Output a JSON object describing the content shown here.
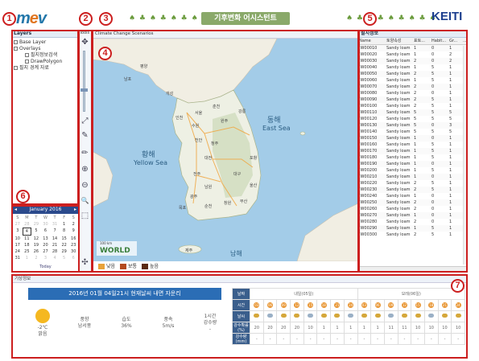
{
  "header": {
    "logo_prefix": "m",
    "logo_o": "e",
    "logo_suffix": "v",
    "title": "기후변화 어시스턴트",
    "org_logo": "KEITI",
    "trees_left": "♠ ♣ ♠ ♣ ♠ ♣ ♠ ♣ ♠ ♣",
    "trees_right": "♠ ♣ ♠ ♣ ♠ ♣ ♠ ♣ ♠"
  },
  "markers": [
    "1",
    "2",
    "3",
    "4",
    "5",
    "6",
    "7"
  ],
  "layers": {
    "title": "Layers",
    "tools_title": "Tools",
    "items": [
      "Base Layer",
      "Overlays",
      "필지정보검색",
      "DrawPolygon",
      "필지 경계 자료"
    ]
  },
  "tools": {
    "icons": [
      "pan-icon",
      "zoom-bar-icon",
      "fullscreen-icon",
      "pencil-icon",
      "pencil-icon",
      "zoom-in-icon",
      "zoom-out-icon",
      "magnifier-icon",
      "select-icon",
      "move-icon"
    ],
    "glyphs": [
      "✥",
      "⤢",
      "✎",
      "✏",
      "⊕",
      "⊖",
      "🔍",
      "⬚",
      "✣"
    ]
  },
  "calendar": {
    "month": "January 2016",
    "prev": "◂",
    "next": "▸",
    "dow": [
      "S",
      "M",
      "T",
      "W",
      "T",
      "F",
      "S"
    ],
    "days": [
      [
        "27",
        "28",
        "29",
        "30",
        "31",
        "1",
        "2"
      ],
      [
        "3",
        "4",
        "5",
        "6",
        "7",
        "8",
        "9"
      ],
      [
        "10",
        "11",
        "12",
        "13",
        "14",
        "15",
        "16"
      ],
      [
        "17",
        "18",
        "19",
        "20",
        "21",
        "22",
        "23"
      ],
      [
        "24",
        "25",
        "26",
        "27",
        "28",
        "29",
        "30"
      ],
      [
        "31",
        "1",
        "2",
        "3",
        "4",
        "5",
        "6"
      ]
    ],
    "selected_day": "4",
    "today_label": "Today"
  },
  "map": {
    "tab_label": "Climate Change Scenarios",
    "legend": [
      {
        "label": "낮음",
        "color": "#e8a23a"
      },
      {
        "label": "보통",
        "color": "#b34a1f"
      },
      {
        "label": "높음",
        "color": "#5a2a12"
      }
    ],
    "sea_labels": [
      "동해",
      "East Sea",
      "황해",
      "Yellow Sea",
      "남해"
    ],
    "place_labels": [
      "서울",
      "인천",
      "수원",
      "천안",
      "대전",
      "청주",
      "전주",
      "광주",
      "대구",
      "울산",
      "부산",
      "포항",
      "강릉",
      "춘천",
      "원주",
      "제주",
      "목포",
      "창원",
      "평양",
      "남포",
      "개성",
      "남원",
      "순천"
    ],
    "world_label": "WORLD",
    "scale_label": "100 km"
  },
  "table": {
    "title": "필지정보",
    "columns": [
      "Name",
      "토양속성",
      "표토...",
      "Habit...",
      "Gr...",
      "..."
    ],
    "rows": [
      [
        "JW00010",
        "Sandy loam",
        "1",
        "0",
        "1"
      ],
      [
        "JW00020",
        "Sandy loam",
        "1",
        "0",
        "2"
      ],
      [
        "JW00030",
        "Sandy loam",
        "2",
        "0",
        "2"
      ],
      [
        "JW00040",
        "Sandy loam",
        "1",
        "5",
        "1"
      ],
      [
        "JW00050",
        "Sandy loam",
        "2",
        "5",
        "1"
      ],
      [
        "JW00060",
        "Sandy loam",
        "1",
        "5",
        "1"
      ],
      [
        "JW00070",
        "Sandy loam",
        "2",
        "0",
        "1"
      ],
      [
        "JW00080",
        "Sandy loam",
        "2",
        "0",
        "1"
      ],
      [
        "JW00090",
        "Sandy loam",
        "2",
        "5",
        "1"
      ],
      [
        "JW00100",
        "Sandy loam",
        "2",
        "5",
        "1"
      ],
      [
        "JW00110",
        "Sandy loam",
        "5",
        "5",
        "5"
      ],
      [
        "JW00120",
        "Sandy loam",
        "5",
        "5",
        "5"
      ],
      [
        "JW00130",
        "Sandy loam",
        "5",
        "0",
        "3"
      ],
      [
        "JW00140",
        "Sandy loam",
        "5",
        "5",
        "5"
      ],
      [
        "JW00150",
        "Sandy loam",
        "1",
        "0",
        "1"
      ],
      [
        "JW00160",
        "Sandy loam",
        "1",
        "5",
        "1"
      ],
      [
        "JW00170",
        "Sandy loam",
        "1",
        "5",
        "1"
      ],
      [
        "JW00180",
        "Sandy loam",
        "1",
        "5",
        "1"
      ],
      [
        "JW00190",
        "Sandy loam",
        "1",
        "0",
        "1"
      ],
      [
        "JW00200",
        "Sandy loam",
        "1",
        "5",
        "1"
      ],
      [
        "JW00210",
        "Sandy loam",
        "1",
        "0",
        "1"
      ],
      [
        "JW00220",
        "Sandy loam",
        "2",
        "5",
        "1"
      ],
      [
        "JW00230",
        "Sandy loam",
        "2",
        "5",
        "1"
      ],
      [
        "JW00240",
        "Sandy loam",
        "1",
        "0",
        "1"
      ],
      [
        "JW00250",
        "Sandy loam",
        "2",
        "0",
        "1"
      ],
      [
        "JW00260",
        "Sandy loam",
        "2",
        "0",
        "1"
      ],
      [
        "JW00270",
        "Sandy loam",
        "1",
        "0",
        "1"
      ],
      [
        "JW00280",
        "Sandy loam",
        "2",
        "0",
        "1"
      ],
      [
        "JW00290",
        "Sandy loam",
        "1",
        "5",
        "1"
      ],
      [
        "JW00300",
        "Sandy loam",
        "2",
        "5",
        "1"
      ]
    ]
  },
  "weather": {
    "panel_title": "기상정보",
    "banner": "2016년 01월 04일21시 현재날씨 내면 자운리",
    "current": [
      {
        "label": "-2℃",
        "sub": "맑음"
      },
      {
        "label": "풍향",
        "sub": "남서풍"
      },
      {
        "label": "습도",
        "sub": "36%"
      },
      {
        "label": "풍속",
        "sub": "5m/s"
      },
      {
        "label": "1시간",
        "sub": "강수량",
        "extra": "-"
      }
    ],
    "forecast": {
      "row_labels": [
        "날짜",
        "시간",
        "날씨",
        "강수확률(%)",
        "강수량(mm)"
      ],
      "day_labels": [
        "내일(05일)",
        "모레(06일)"
      ],
      "hours": [
        "03",
        "06",
        "09",
        "12",
        "15",
        "18",
        "21",
        "24",
        "03",
        "06",
        "09",
        "12",
        "15",
        "18",
        "21",
        "24"
      ],
      "pop": [
        "20",
        "20",
        "20",
        "20",
        "10",
        "1",
        "1",
        "1",
        "1",
        "1",
        "11",
        "11",
        "10",
        "10",
        "10",
        "10"
      ],
      "rain": [
        "-",
        "-",
        "-",
        "-",
        "-",
        "-",
        "-",
        "-",
        "-",
        "-",
        "-",
        "-",
        "-",
        "-",
        "-",
        "-"
      ]
    }
  }
}
